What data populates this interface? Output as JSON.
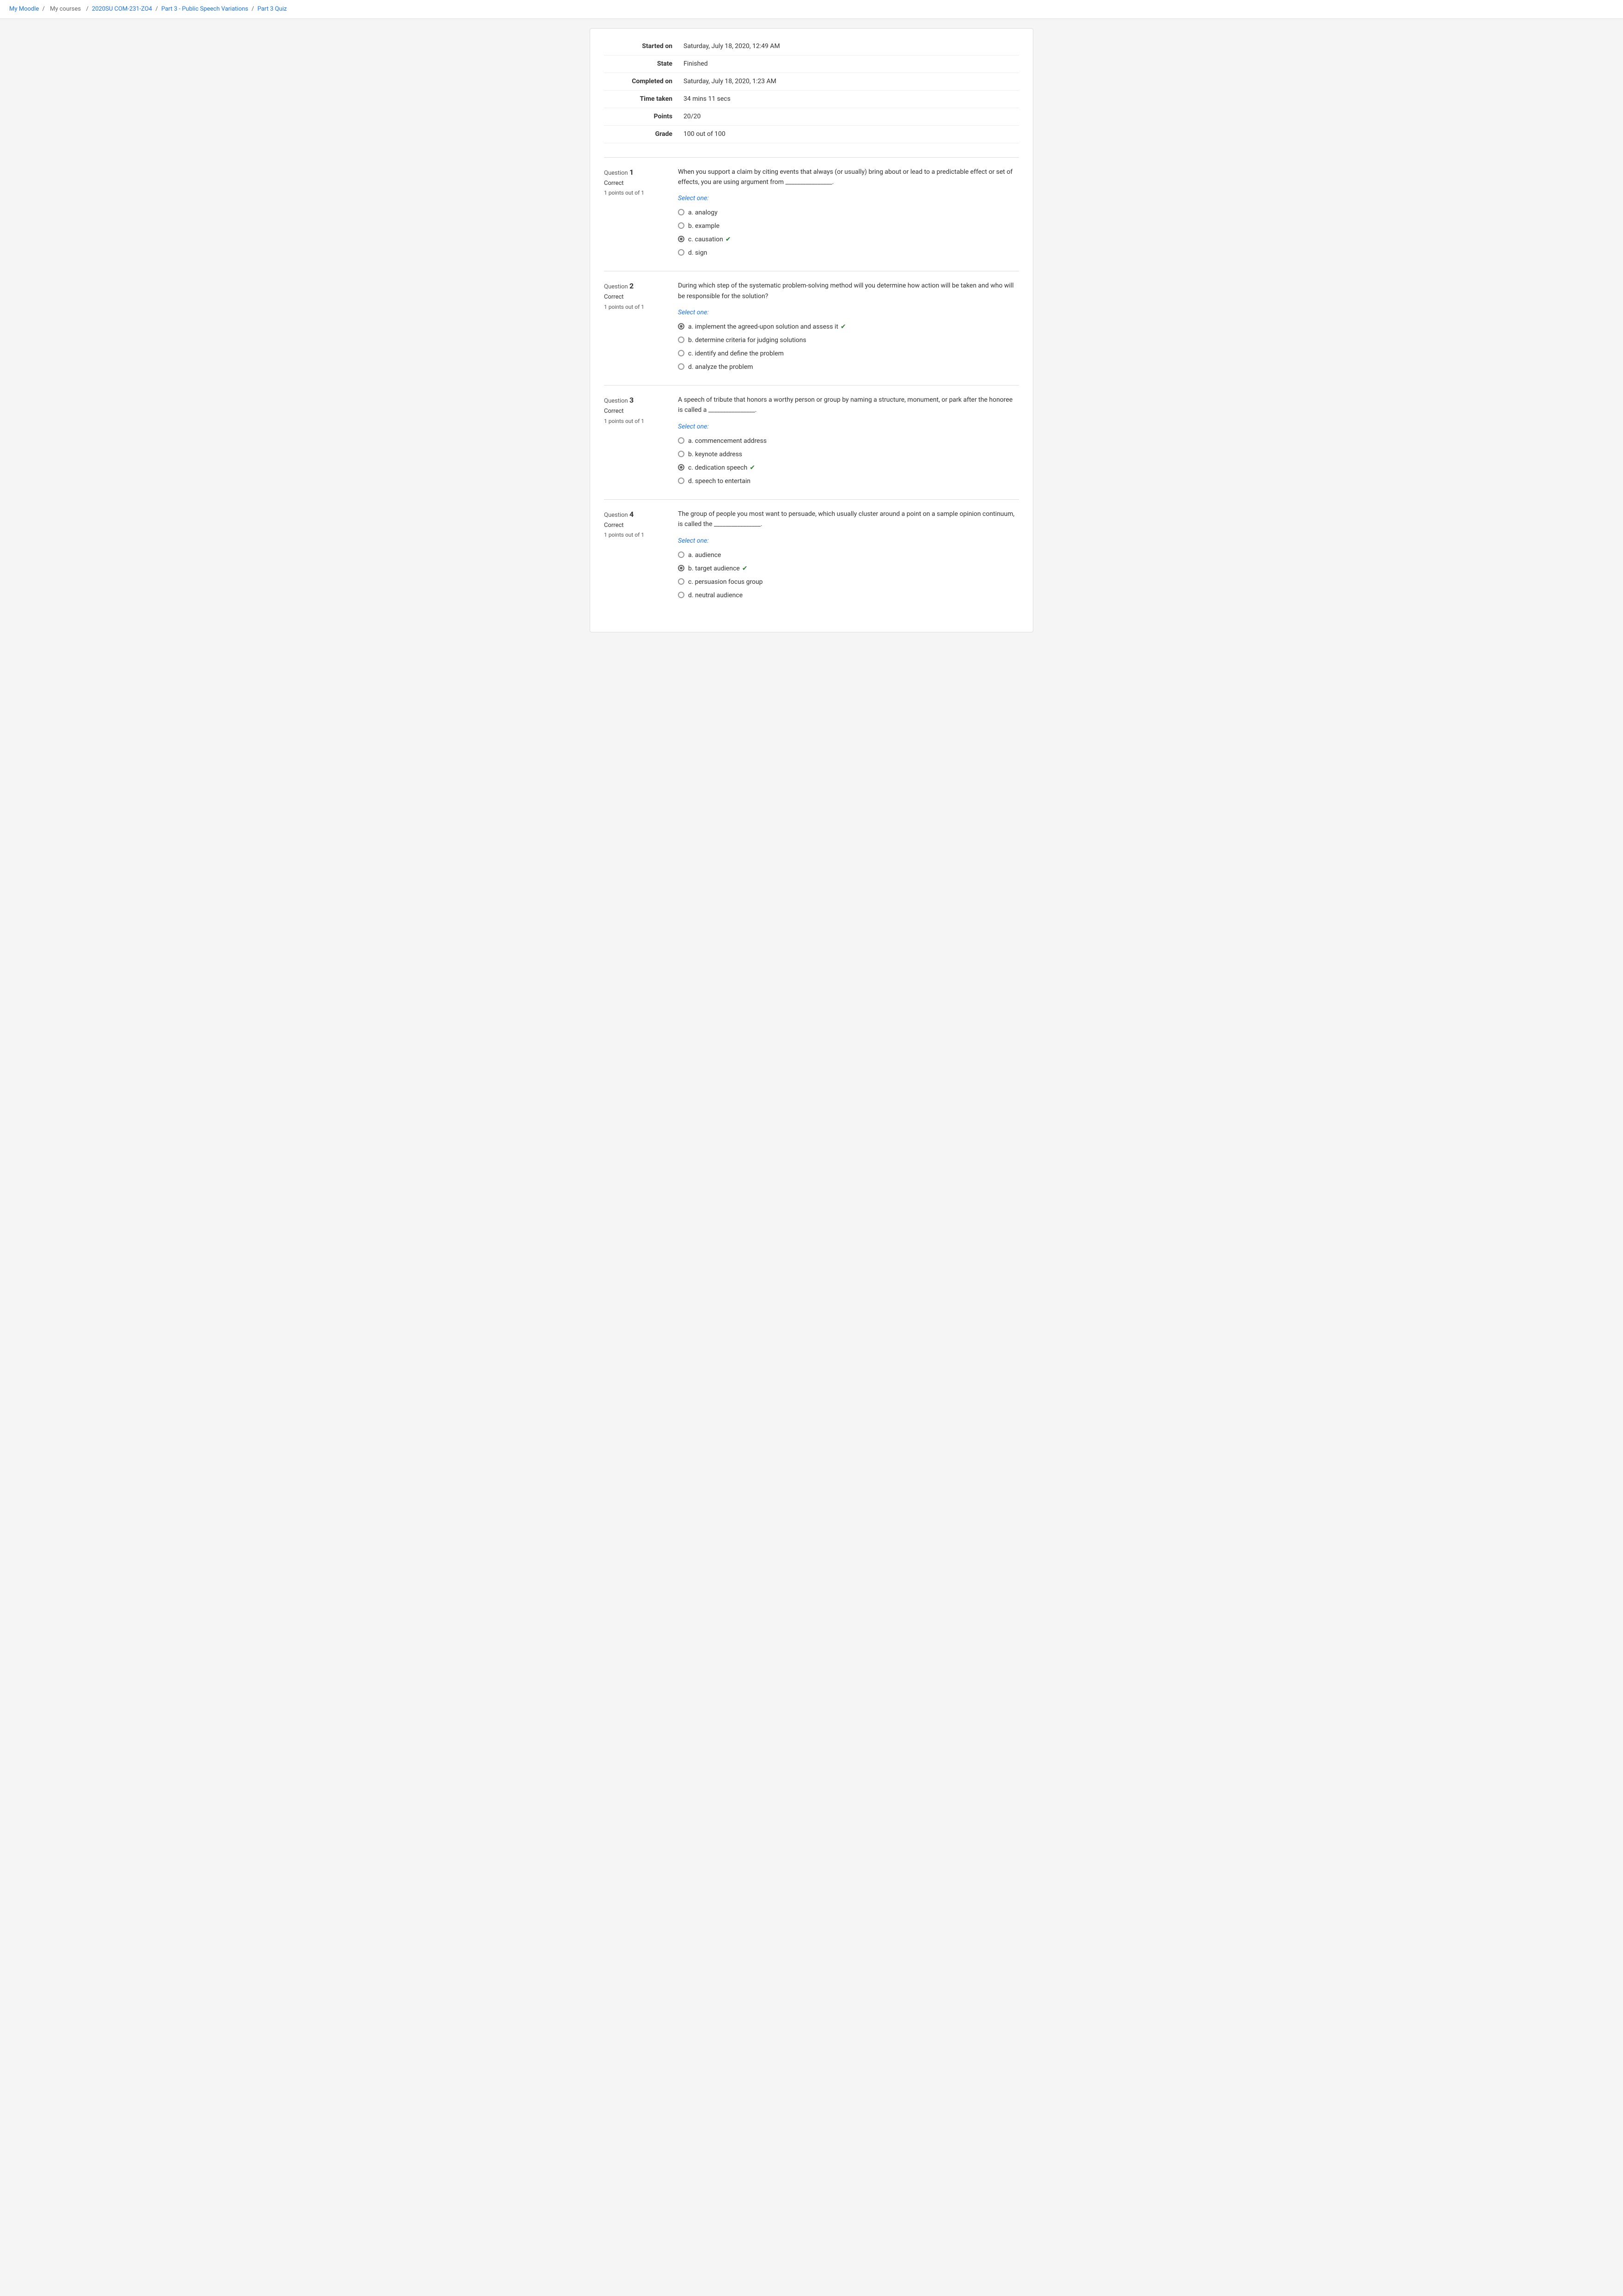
{
  "breadcrumb": {
    "my_moodle": "My Moodle",
    "my_courses": "My courses",
    "course": "2020SU COM-231-ZO4",
    "part": "Part 3 - Public Speech Variations",
    "quiz": "Part 3 Quiz"
  },
  "summary": {
    "started_on_label": "Started on",
    "started_on_value": "Saturday, July 18, 2020, 12:49 AM",
    "state_label": "State",
    "state_value": "Finished",
    "completed_on_label": "Completed on",
    "completed_on_value": "Saturday, July 18, 2020, 1:23 AM",
    "time_taken_label": "Time taken",
    "time_taken_value": "34 mins 11 secs",
    "points_label": "Points",
    "points_value": "20/20",
    "grade_label": "Grade",
    "grade_value": "100 out of 100"
  },
  "questions": [
    {
      "number": "1",
      "status": "Correct",
      "points": "1 points out of 1",
      "text": "When you support a claim by citing events that always (or usually) bring about or lead to a predictable effect or set of effects, you are using argument from ________________.",
      "select_label": "Select one:",
      "options": [
        {
          "letter": "a",
          "text": "analogy",
          "selected": false,
          "correct": false
        },
        {
          "letter": "b",
          "text": "example",
          "selected": false,
          "correct": false
        },
        {
          "letter": "c",
          "text": "causation",
          "selected": true,
          "correct": true
        },
        {
          "letter": "d",
          "text": "sign",
          "selected": false,
          "correct": false
        }
      ]
    },
    {
      "number": "2",
      "status": "Correct",
      "points": "1 points out of 1",
      "text": "During which step of the systematic problem-solving method will you determine how action will be taken and who will be responsible for the solution?",
      "select_label": "Select one:",
      "options": [
        {
          "letter": "a",
          "text": "implement the agreed-upon solution and assess it",
          "selected": true,
          "correct": true
        },
        {
          "letter": "b",
          "text": "determine criteria for judging solutions",
          "selected": false,
          "correct": false
        },
        {
          "letter": "c",
          "text": "identify and define the problem",
          "selected": false,
          "correct": false
        },
        {
          "letter": "d",
          "text": "analyze the problem",
          "selected": false,
          "correct": false
        }
      ]
    },
    {
      "number": "3",
      "status": "Correct",
      "points": "1 points out of 1",
      "text": "A speech of tribute that honors a worthy person or group by naming a structure, monument, or park after the honoree is called a ________________.",
      "select_label": "Select one:",
      "options": [
        {
          "letter": "a",
          "text": "commencement address",
          "selected": false,
          "correct": false
        },
        {
          "letter": "b",
          "text": "keynote address",
          "selected": false,
          "correct": false
        },
        {
          "letter": "c",
          "text": "dedication speech",
          "selected": true,
          "correct": true
        },
        {
          "letter": "d",
          "text": "speech to entertain",
          "selected": false,
          "correct": false
        }
      ]
    },
    {
      "number": "4",
      "status": "Correct",
      "points": "1 points out of 1",
      "text": "The group of people you most want to persuade, which usually cluster around a point on a sample opinion continuum, is called the ________________.",
      "select_label": "Select one:",
      "options": [
        {
          "letter": "a",
          "text": "audience",
          "selected": false,
          "correct": false
        },
        {
          "letter": "b",
          "text": "target audience",
          "selected": true,
          "correct": true
        },
        {
          "letter": "c",
          "text": "persuasion focus group",
          "selected": false,
          "correct": false
        },
        {
          "letter": "d",
          "text": "neutral audience",
          "selected": false,
          "correct": false
        }
      ]
    }
  ]
}
